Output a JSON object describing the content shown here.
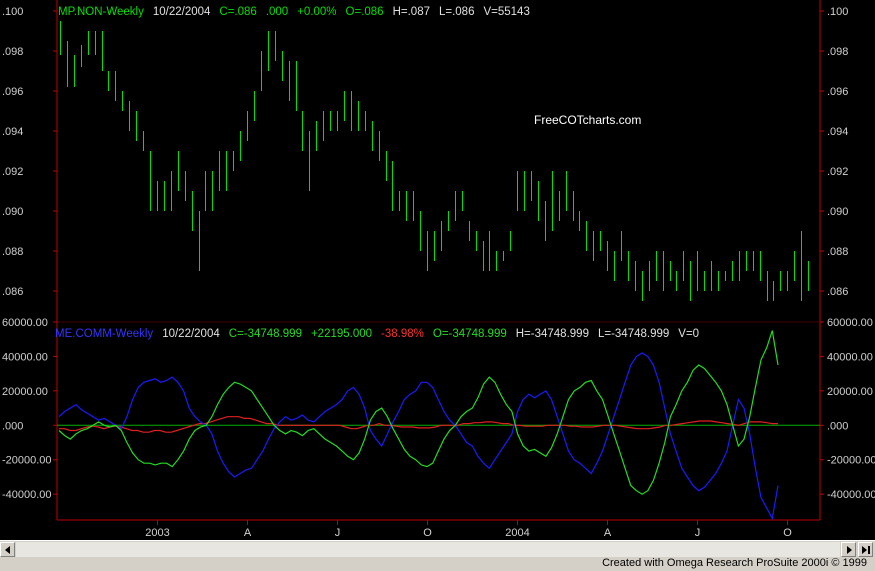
{
  "window": {
    "credit": "Created with Omega Research ProSuite 2000i © 1999"
  },
  "watermark": "FreeCOTcharts.com",
  "colors": {
    "price": "#00e000",
    "frame": "#c00000",
    "zero": "#00b000",
    "blue": "#1a1aff",
    "green": "#22dd22",
    "red": "#e02020",
    "label": "#d0d0d0"
  },
  "header1": [
    {
      "text": "MP.NON-Weekly",
      "color": "#00e000"
    },
    {
      "text": "10/22/2004",
      "color": "#e0e0e0"
    },
    {
      "text": "C=.086",
      "color": "#00e000"
    },
    {
      "text": ".000",
      "color": "#00e000"
    },
    {
      "text": "+0.00%",
      "color": "#00e000"
    },
    {
      "text": "O=.086",
      "color": "#00e000"
    },
    {
      "text": "H=.087",
      "color": "#e0e0e0"
    },
    {
      "text": "L=.086",
      "color": "#e0e0e0"
    },
    {
      "text": "V=55143",
      "color": "#e0e0e0"
    }
  ],
  "header2": [
    {
      "text": "ME.COMM-Weekly",
      "color": "#3333ff"
    },
    {
      "text": "10/22/2004",
      "color": "#e0e0e0"
    },
    {
      "text": "C=-34748.999",
      "color": "#22dd22"
    },
    {
      "text": "+22195.000",
      "color": "#22dd22"
    },
    {
      "text": "-38.98%",
      "color": "#ff3030"
    },
    {
      "text": "O=-34748.999",
      "color": "#22dd22"
    },
    {
      "text": "H=-34748.999",
      "color": "#e0e0e0"
    },
    {
      "text": "L=-34748.999",
      "color": "#e0e0e0"
    },
    {
      "text": "V=0",
      "color": "#e0e0e0"
    }
  ],
  "chart_data": [
    {
      "type": "ohlc",
      "title": "MP.NON-Weekly",
      "x_labels": [
        "2003",
        "A",
        "J",
        "O",
        "2004",
        "A",
        "J",
        "O"
      ],
      "x_label_weeks": [
        14,
        27,
        40,
        53,
        66,
        79,
        92,
        105
      ],
      "y_ticks": [
        ".100",
        ".098",
        ".096",
        ".094",
        ".092",
        ".090",
        ".088",
        ".086"
      ],
      "ylim": [
        0.0845,
        0.1003
      ],
      "series": [
        {
          "name": "MP.NON-Weekly",
          "bars": [
            [
              0.0995,
              0.0978
            ],
            [
              0.0985,
              0.0962
            ],
            [
              0.0978,
              0.0962
            ],
            [
              0.0983,
              0.0972
            ],
            [
              0.099,
              0.0978
            ],
            [
              0.099,
              0.0978
            ],
            [
              0.099,
              0.097
            ],
            [
              0.097,
              0.096
            ],
            [
              0.097,
              0.0955
            ],
            [
              0.096,
              0.095
            ],
            [
              0.0955,
              0.094
            ],
            [
              0.095,
              0.0935
            ],
            [
              0.094,
              0.093
            ],
            [
              0.093,
              0.09
            ],
            [
              0.0915,
              0.09
            ],
            [
              0.0915,
              0.09
            ],
            [
              0.092,
              0.09
            ],
            [
              0.093,
              0.091
            ],
            [
              0.092,
              0.0905
            ],
            [
              0.091,
              0.089
            ],
            [
              0.09,
              0.087
            ],
            [
              0.092,
              0.09
            ],
            [
              0.092,
              0.09
            ],
            [
              0.093,
              0.091
            ],
            [
              0.093,
              0.091
            ],
            [
              0.093,
              0.092
            ],
            [
              0.094,
              0.0925
            ],
            [
              0.095,
              0.0935
            ],
            [
              0.096,
              0.0945
            ],
            [
              0.098,
              0.096
            ],
            [
              0.099,
              0.097
            ],
            [
              0.099,
              0.0975
            ],
            [
              0.098,
              0.0965
            ],
            [
              0.0975,
              0.0955
            ],
            [
              0.0975,
              0.095
            ],
            [
              0.095,
              0.093
            ],
            [
              0.094,
              0.091
            ],
            [
              0.0945,
              0.093
            ],
            [
              0.095,
              0.0935
            ],
            [
              0.095,
              0.094
            ],
            [
              0.095,
              0.094
            ],
            [
              0.096,
              0.0945
            ],
            [
              0.096,
              0.094
            ],
            [
              0.0955,
              0.094
            ],
            [
              0.095,
              0.094
            ],
            [
              0.0945,
              0.093
            ],
            [
              0.094,
              0.0925
            ],
            [
              0.093,
              0.0915
            ],
            [
              0.0925,
              0.09
            ],
            [
              0.091,
              0.09
            ],
            [
              0.091,
              0.0895
            ],
            [
              0.091,
              0.0895
            ],
            [
              0.09,
              0.088
            ],
            [
              0.089,
              0.087
            ],
            [
              0.089,
              0.0875
            ],
            [
              0.0895,
              0.088
            ],
            [
              0.09,
              0.089
            ],
            [
              0.091,
              0.0895
            ],
            [
              0.091,
              0.09
            ],
            [
              0.0895,
              0.0885
            ],
            [
              0.089,
              0.088
            ],
            [
              0.0885,
              0.087
            ],
            [
              0.089,
              0.087
            ],
            [
              0.088,
              0.087
            ],
            [
              0.088,
              0.0875
            ],
            [
              0.089,
              0.088
            ],
            [
              0.092,
              0.09
            ],
            [
              0.092,
              0.09
            ],
            [
              0.092,
              0.0905
            ],
            [
              0.0915,
              0.0895
            ],
            [
              0.0905,
              0.0885
            ],
            [
              0.092,
              0.089
            ],
            [
              0.091,
              0.0895
            ],
            [
              0.092,
              0.09
            ],
            [
              0.091,
              0.0895
            ],
            [
              0.09,
              0.089
            ],
            [
              0.0895,
              0.088
            ],
            [
              0.089,
              0.0875
            ],
            [
              0.089,
              0.088
            ],
            [
              0.0885,
              0.087
            ],
            [
              0.088,
              0.0865
            ],
            [
              0.089,
              0.0875
            ],
            [
              0.088,
              0.0865
            ],
            [
              0.0875,
              0.086
            ],
            [
              0.087,
              0.0855
            ],
            [
              0.0875,
              0.086
            ],
            [
              0.088,
              0.0865
            ],
            [
              0.088,
              0.086
            ],
            [
              0.0875,
              0.0865
            ],
            [
              0.087,
              0.086
            ],
            [
              0.088,
              0.0865
            ],
            [
              0.0875,
              0.0855
            ],
            [
              0.088,
              0.086
            ],
            [
              0.087,
              0.086
            ],
            [
              0.0875,
              0.086
            ],
            [
              0.087,
              0.086
            ],
            [
              0.087,
              0.0865
            ],
            [
              0.0875,
              0.0865
            ],
            [
              0.088,
              0.0865
            ],
            [
              0.088,
              0.087
            ],
            [
              0.088,
              0.087
            ],
            [
              0.088,
              0.0865
            ],
            [
              0.087,
              0.0855
            ],
            [
              0.0865,
              0.0855
            ],
            [
              0.087,
              0.086
            ],
            [
              0.087,
              0.086
            ],
            [
              0.088,
              0.0865
            ],
            [
              0.089,
              0.0855
            ],
            [
              0.0875,
              0.086
            ]
          ]
        }
      ]
    },
    {
      "type": "line",
      "title": "ME.COMM-Weekly",
      "x_labels": [
        "2003",
        "A",
        "J",
        "O",
        "2004",
        "A",
        "J",
        "O"
      ],
      "y_ticks": [
        "60000.00",
        "40000.00",
        "20000.00",
        ".000",
        "-20000.00",
        "-40000.00"
      ],
      "ylim": [
        -55000,
        60000
      ],
      "series": [
        {
          "name": "",
          "color": "blue",
          "values": [
            5000,
            8000,
            10000,
            12000,
            9000,
            7000,
            5000,
            3000,
            4000,
            2000,
            0,
            -2000,
            5000,
            15000,
            22000,
            25000,
            26000,
            27000,
            25000,
            26000,
            28000,
            25000,
            20000,
            10000,
            5000,
            2000,
            0,
            -5000,
            -15000,
            -22000,
            -27000,
            -30000,
            -28000,
            -26000,
            -25000,
            -20000,
            -15000,
            -8000,
            -2000,
            2000,
            5000,
            3000,
            4000,
            6000,
            3000,
            2000,
            5000,
            8000,
            10000,
            12000,
            15000,
            20000,
            22000,
            18000,
            10000,
            -3000,
            -8000,
            -12000,
            -5000,
            2000,
            8000,
            15000,
            18000,
            20000,
            25000,
            25000,
            22000,
            15000,
            8000,
            3000,
            0,
            -5000,
            -10000,
            -12000,
            -18000,
            -22000,
            -25000,
            -20000,
            -15000,
            -10000,
            -5000,
            8000,
            15000,
            18000,
            16000,
            18000,
            20000,
            15000,
            5000,
            -5000,
            -15000,
            -20000,
            -22000,
            -25000,
            -28000,
            -22000,
            -15000,
            -5000,
            5000,
            15000,
            25000,
            35000,
            40000,
            42000,
            40000,
            35000,
            25000,
            10000,
            -5000,
            -15000,
            -25000,
            -30000,
            -35000,
            -38000,
            -36000,
            -32000,
            -28000,
            -22000,
            -15000,
            0,
            15000,
            10000,
            -5000,
            -25000,
            -42000,
            -48000,
            -54000,
            -35000
          ]
        },
        {
          "name": "",
          "color": "green",
          "values": [
            -3000,
            -6000,
            -8000,
            -5000,
            -3000,
            -2000,
            0,
            2000,
            0,
            -1000,
            0,
            -3000,
            -10000,
            -16000,
            -20000,
            -22000,
            -22000,
            -23000,
            -22000,
            -22000,
            -24000,
            -20000,
            -15000,
            -8000,
            -3000,
            -1000,
            0,
            5000,
            12000,
            18000,
            22000,
            25000,
            24000,
            22000,
            20000,
            15000,
            10000,
            5000,
            0,
            -3000,
            -5000,
            -3000,
            -4000,
            -6000,
            -3000,
            -2000,
            -5000,
            -8000,
            -10000,
            -12000,
            -15000,
            -18000,
            -20000,
            -16000,
            -8000,
            3000,
            8000,
            10000,
            5000,
            -2000,
            -8000,
            -14000,
            -18000,
            -20000,
            -23000,
            -24000,
            -22000,
            -15000,
            -8000,
            -3000,
            0,
            5000,
            8000,
            10000,
            16000,
            24000,
            28000,
            25000,
            18000,
            12000,
            8000,
            -5000,
            -12000,
            -15000,
            -14000,
            -16000,
            -18000,
            -13000,
            -5000,
            5000,
            15000,
            20000,
            22000,
            25000,
            26000,
            20000,
            15000,
            5000,
            -5000,
            -15000,
            -25000,
            -35000,
            -38000,
            -40000,
            -38000,
            -32000,
            -22000,
            -10000,
            5000,
            12000,
            20000,
            25000,
            32000,
            35000,
            33000,
            29000,
            25000,
            20000,
            12000,
            0,
            -12000,
            -8000,
            5000,
            22000,
            38000,
            45000,
            55000,
            35000
          ]
        },
        {
          "name": "",
          "color": "red",
          "values": [
            -2000,
            -2000,
            -3000,
            -3000,
            -2000,
            -1000,
            -500,
            -1000,
            -2000,
            -1000,
            -500,
            -1000,
            -2000,
            -3000,
            -3000,
            -4000,
            -4000,
            -3000,
            -3000,
            -4000,
            -4000,
            -3000,
            -2000,
            -1000,
            0,
            1000,
            1000,
            2000,
            3000,
            4000,
            5000,
            5000,
            5000,
            4000,
            4000,
            3000,
            2000,
            1000,
            1000,
            0,
            0,
            0,
            0,
            0,
            0,
            0,
            0,
            0,
            0,
            0,
            0,
            -1000,
            -2000,
            -2000,
            -1000,
            0,
            0,
            1000,
            0,
            0,
            -500,
            -1000,
            -1000,
            -1000,
            -1500,
            -1500,
            -1500,
            -1000,
            0,
            0,
            0,
            0,
            1000,
            1000,
            1500,
            1500,
            2000,
            2000,
            1500,
            1000,
            1000,
            0,
            0,
            -500,
            -500,
            -500,
            -500,
            0,
            0,
            0,
            0,
            -500,
            -500,
            -1000,
            -1000,
            -1000,
            -500,
            0,
            0,
            0,
            -500,
            -1000,
            -1500,
            -2000,
            -2000,
            -2000,
            -1500,
            -1000,
            0,
            0,
            500,
            1000,
            1500,
            2000,
            2500,
            2500,
            2500,
            2000,
            1500,
            1000,
            500,
            0,
            1000,
            2000,
            2000,
            2000,
            1500,
            1000,
            1000
          ]
        }
      ]
    }
  ]
}
